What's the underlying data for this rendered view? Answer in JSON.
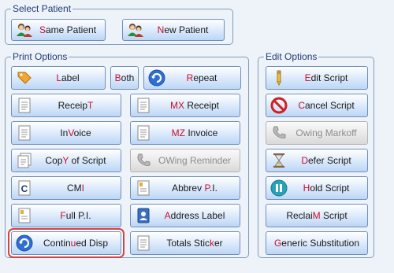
{
  "select_patient": {
    "title": "Select Patient",
    "same_patient": {
      "pre": "",
      "hk": "S",
      "post": "ame Patient"
    },
    "new_patient": {
      "pre": "",
      "hk": "N",
      "post": "ew Patient"
    }
  },
  "print_options": {
    "title": "Print Options",
    "label": {
      "pre": "",
      "hk": "L",
      "post": "abel"
    },
    "both": {
      "pre": "",
      "hk": "B",
      "post": "oth"
    },
    "repeat": {
      "pre": "",
      "hk": "R",
      "post": "epeat"
    },
    "receipt": {
      "pre": "Receip",
      "hk": "T",
      "post": ""
    },
    "mx_receipt": {
      "pre": "",
      "hk": "MX",
      "post": " Receipt"
    },
    "invoice": {
      "pre": "In",
      "hk": "V",
      "post": "oice"
    },
    "mz_invoice": {
      "pre": "",
      "hk": "MZ",
      "post": " Invoice"
    },
    "copy_of_script": {
      "pre": "Cop",
      "hk": "Y",
      "post": " of Script"
    },
    "owing_reminder": {
      "pre": "OWing Reminder",
      "hk": "",
      "post": ""
    },
    "cmi": {
      "pre": "CM",
      "hk": "I",
      "post": ""
    },
    "abbrev_pi": {
      "pre": "Abbrev ",
      "hk": "P",
      "post": ".I."
    },
    "full_pi": {
      "pre": "",
      "hk": "F",
      "post": "ull P.I."
    },
    "address_label": {
      "pre": "",
      "hk": "A",
      "post": "ddress Label"
    },
    "continued_disp": {
      "pre": "Contin",
      "hk": "u",
      "post": "ed Disp"
    },
    "totals_sticker": {
      "pre": "Totals Stic",
      "hk": "k",
      "post": "er"
    }
  },
  "edit_options": {
    "title": "Edit Options",
    "edit_script": {
      "pre": "",
      "hk": "E",
      "post": "dit Script"
    },
    "cancel_script": {
      "pre": "",
      "hk": "C",
      "post": "ancel Script"
    },
    "owing_markoff": {
      "pre": "",
      "hk": "O",
      "post": "wing Markoff"
    },
    "defer_script": {
      "pre": "",
      "hk": "D",
      "post": "efer Script"
    },
    "hold_script": {
      "pre": "",
      "hk": "H",
      "post": "old Script"
    },
    "reclaim_script": {
      "pre": "Reclai",
      "hk": "M",
      "post": " Script"
    },
    "generic_substitution": {
      "pre": "",
      "hk": "G",
      "post": "eneric Substitution"
    }
  },
  "icons": {
    "same_patient": "patients-icon",
    "new_patient": "patients-icon",
    "label": "tag-icon",
    "repeat": "refresh-icon",
    "receipt": "document-icon",
    "mx_receipt": "document-icon",
    "invoice": "document-icon",
    "mz_invoice": "document-icon",
    "copy_of_script": "copy-icon",
    "owing_reminder": "phone-icon",
    "cmi": "cmi-icon",
    "abbrev_pi": "document-icon",
    "full_pi": "document-icon",
    "address_label": "address-book-icon",
    "continued_disp": "refresh-icon",
    "totals_sticker": "document-icon",
    "edit_script": "pencil-icon",
    "cancel_script": "no-entry-icon",
    "owing_markoff": "phone-icon",
    "defer_script": "hourglass-icon",
    "hold_script": "pause-icon"
  },
  "colors": {
    "hotkey": "#c8102e",
    "group_title": "#1f3a78",
    "selected_outline": "#d94040"
  }
}
